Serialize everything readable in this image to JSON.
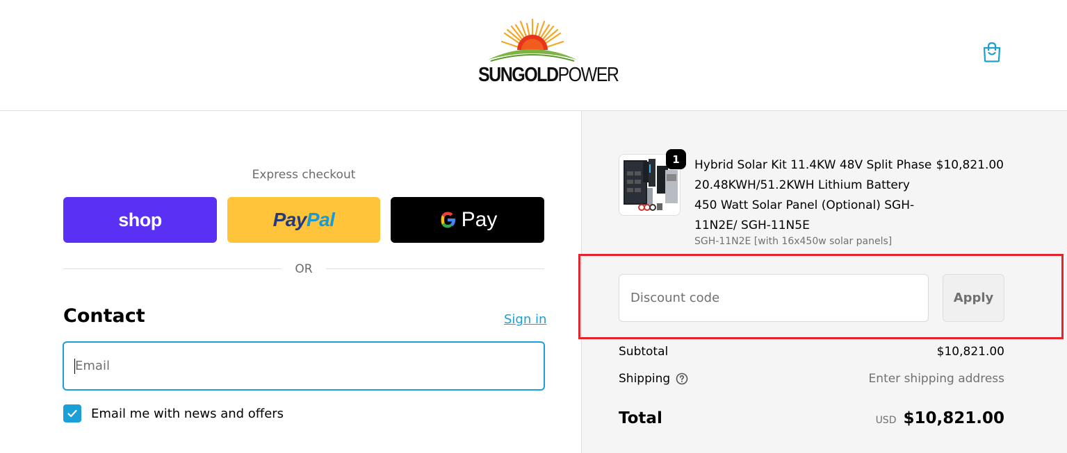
{
  "header": {
    "logo_text_bold": "SUNGOLD",
    "logo_text_light": "POWER",
    "cart_icon": "shopping-bag-icon"
  },
  "express": {
    "label": "Express checkout",
    "shop_label": "shop",
    "paypal_label_1": "Pay",
    "paypal_label_2": "Pal",
    "gpay_letter": "G",
    "gpay_label": "Pay",
    "or_label": "OR"
  },
  "contact": {
    "title": "Contact",
    "sign_in": "Sign in",
    "email_placeholder": "Email",
    "newsletter_label": "Email me with news and offers",
    "newsletter_checked": true
  },
  "order": {
    "item": {
      "quantity": "1",
      "title": "Hybrid Solar Kit 11.4KW 48V Split Phase 20.48KWH/51.2KWH Lithium Battery 450 Watt Solar Panel (Optional) SGH-11N2E/ SGH-11N5E",
      "variant": "SGH-11N2E [with 16x450w solar panels]",
      "price": "$10,821.00"
    },
    "discount_placeholder": "Discount code",
    "apply_label": "Apply",
    "subtotal_label": "Subtotal",
    "subtotal_value": "$10,821.00",
    "shipping_label": "Shipping",
    "shipping_value": "Enter shipping address",
    "total_label": "Total",
    "currency": "USD",
    "total_value": "$10,821.00"
  },
  "colors": {
    "accent": "#1a9fd6",
    "shop_purple": "#5a31f4",
    "paypal_yellow": "#ffc439",
    "highlight_red": "#e3242b"
  }
}
